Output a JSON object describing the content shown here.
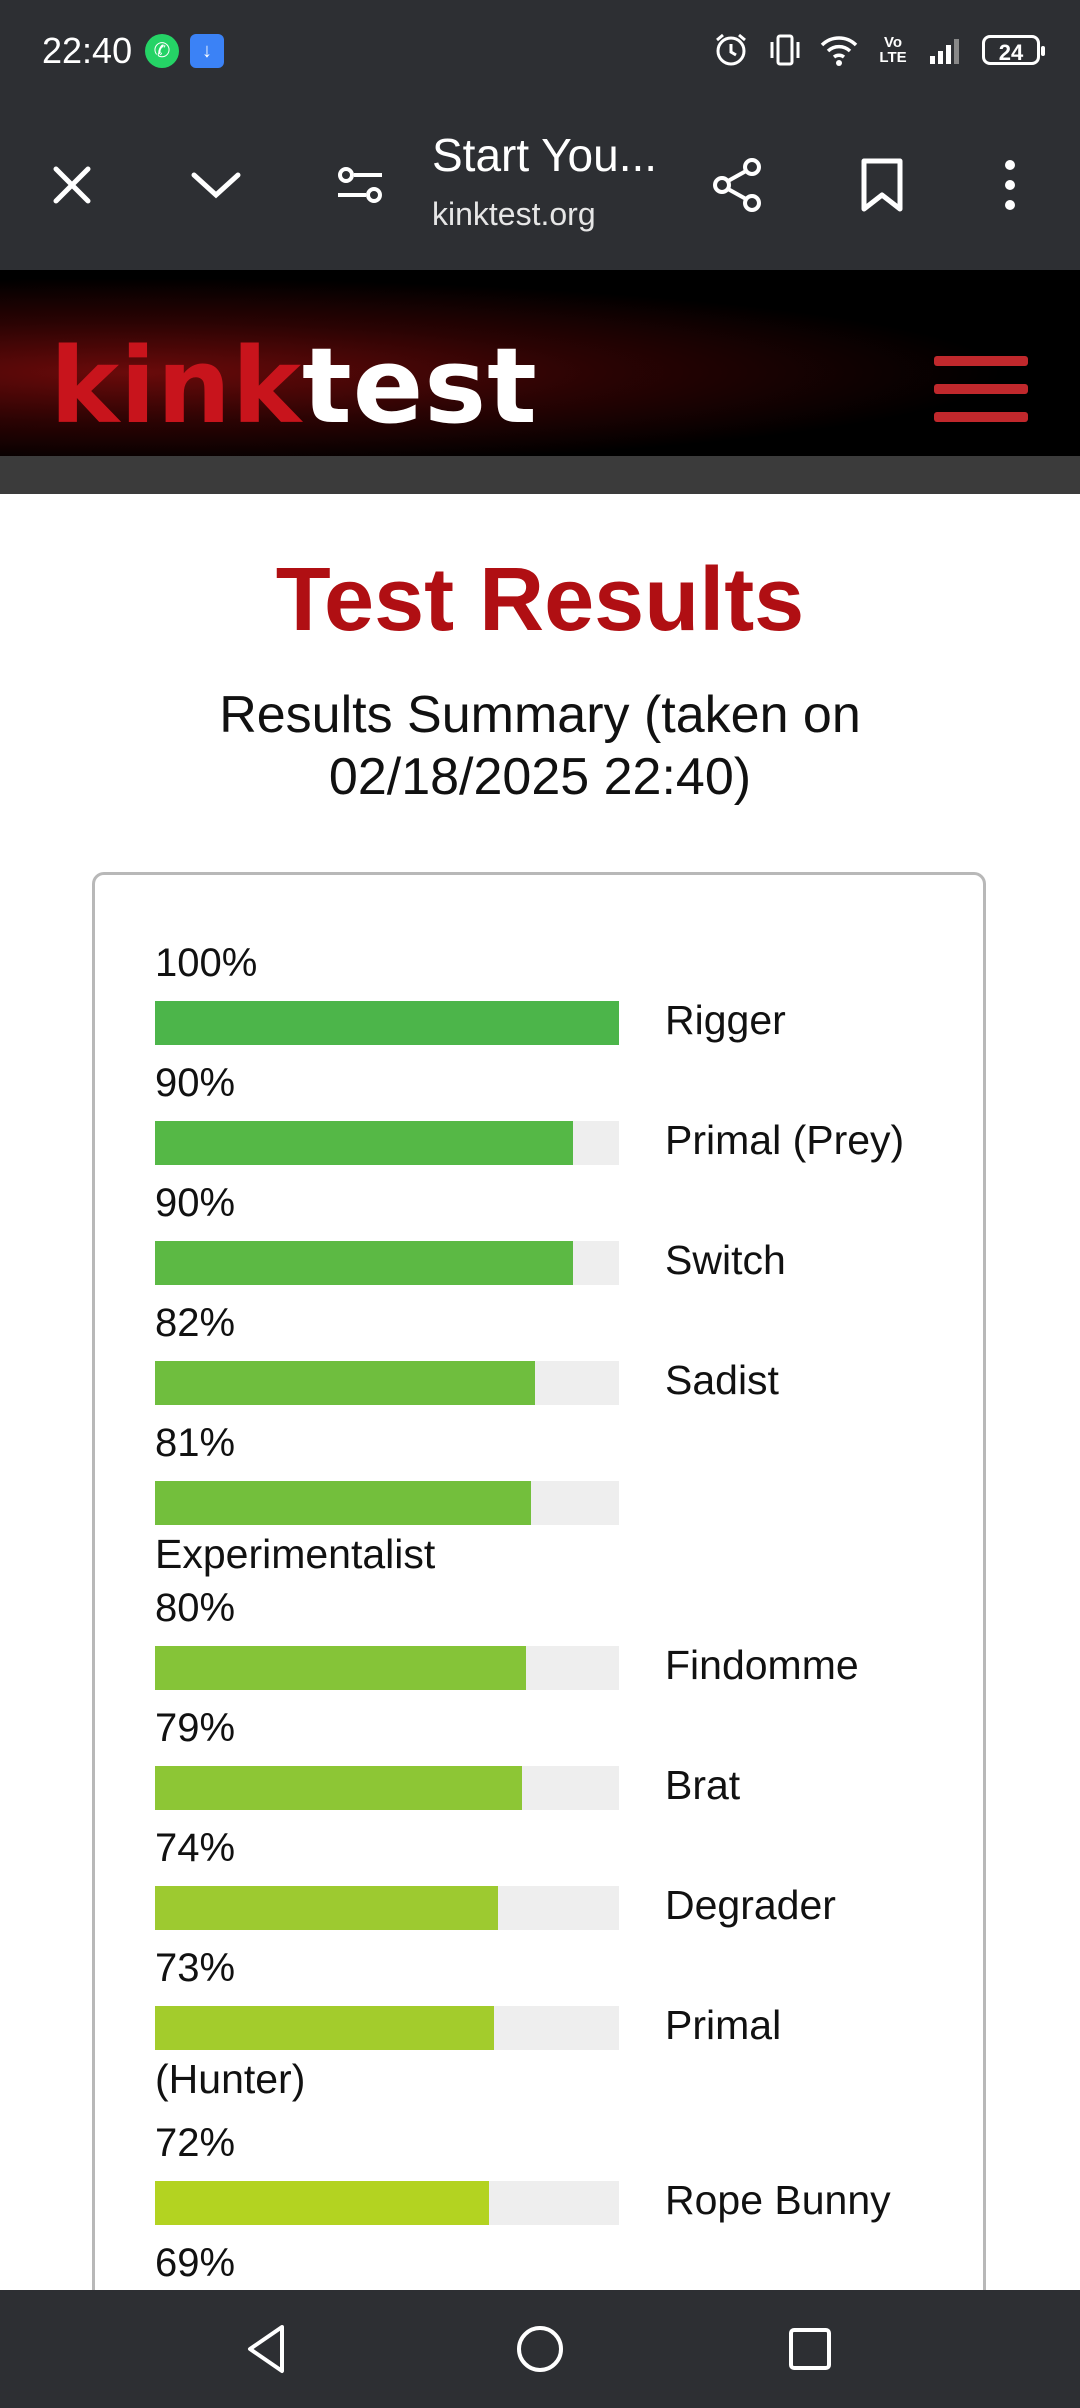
{
  "status_bar": {
    "time": "22:40",
    "notification_icons": [
      "whatsapp-icon",
      "download-icon"
    ],
    "system_icons": [
      "alarm-icon",
      "vibrate-icon",
      "wifi-icon",
      "volte-icon",
      "signal-icon"
    ],
    "volte_label": "Vo\nLTE",
    "battery": "24"
  },
  "browser": {
    "tab_title": "Start You...",
    "url": "kinktest.org",
    "buttons": [
      "close-icon",
      "chevron-down-icon",
      "page-settings-icon",
      "share-icon",
      "bookmark-icon",
      "more-icon"
    ]
  },
  "site": {
    "logo_part1": "kink",
    "logo_part2": "test",
    "menu_color": "#c0282c"
  },
  "page": {
    "title": "Test Results",
    "summary_line1": "Results Summary (taken on",
    "summary_line2": "02/18/2025 22:40)"
  },
  "results": [
    {
      "percent": "100%",
      "value": 100,
      "label": "Rigger",
      "color": "#4cb54a"
    },
    {
      "percent": "90%",
      "value": 90,
      "label": "Primal (Prey)",
      "color": "#55b846"
    },
    {
      "percent": "90%",
      "value": 90,
      "label": "Switch",
      "color": "#5cb944"
    },
    {
      "percent": "82%",
      "value": 82,
      "label": "Sadist",
      "color": "#6fbe3e"
    },
    {
      "percent": "81%",
      "value": 81,
      "label": "Experimentalist",
      "color": "#73bf3c"
    },
    {
      "percent": "80%",
      "value": 80,
      "label": "Findomme",
      "color": "#85c438"
    },
    {
      "percent": "79%",
      "value": 79,
      "label": "Brat",
      "color": "#8dc635"
    },
    {
      "percent": "74%",
      "value": 74,
      "label": "Degrader",
      "color": "#9dca30"
    },
    {
      "percent": "73%",
      "value": 73,
      "label_line1": "Primal",
      "label_line2": "(Hunter)",
      "color": "#a3cc2c"
    },
    {
      "percent": "72%",
      "value": 72,
      "label": "Rope Bunny",
      "color": "#b3d321"
    },
    {
      "percent": "69%"
    }
  ],
  "nav": [
    "back-icon",
    "home-icon",
    "recents-icon"
  ]
}
